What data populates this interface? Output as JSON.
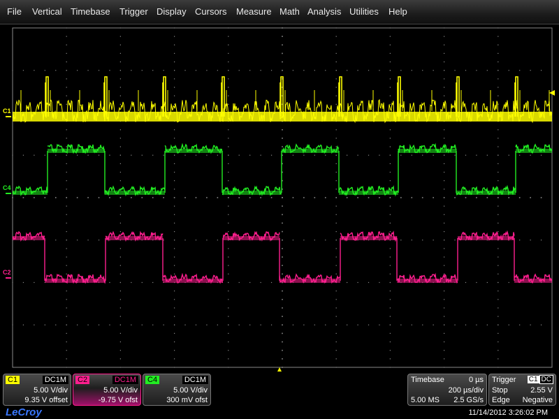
{
  "menu": [
    "File",
    "Vertical",
    "Timebase",
    "Trigger",
    "Display",
    "Cursors",
    "Measure",
    "Math",
    "Analysis",
    "Utilities",
    "Help"
  ],
  "colors": {
    "c1": "#ffff00",
    "c2": "#ff1f8f",
    "c4": "#22ee22",
    "grid": "#8a8a8a",
    "trigger_marker": "#ffff00"
  },
  "channels": {
    "c1": {
      "label": "C1",
      "coupling": "DC1M",
      "vdiv": "5.00 V/div",
      "offset": "9.35 V offset"
    },
    "c2": {
      "label": "C2",
      "coupling": "DC1M",
      "vdiv": "5.00 V/div",
      "offset": "-9.75 V ofst"
    },
    "c4": {
      "label": "C4",
      "coupling": "DC1M",
      "vdiv": "5.00 V/div",
      "offset": "300 mV ofst"
    }
  },
  "timebase": {
    "title": "Timebase",
    "delay": "0 µs",
    "tdiv": "200 µs/div",
    "points": "5.00 MS",
    "rate": "2.5 GS/s"
  },
  "trigger": {
    "title": "Trigger",
    "source": "C1",
    "coupling": "DC",
    "mode": "Stop",
    "level": "2.55 V",
    "type": "Edge",
    "slope": "Negative"
  },
  "logo": "LeCroy",
  "timestamp": "11/14/2012 3:26:02 PM"
}
